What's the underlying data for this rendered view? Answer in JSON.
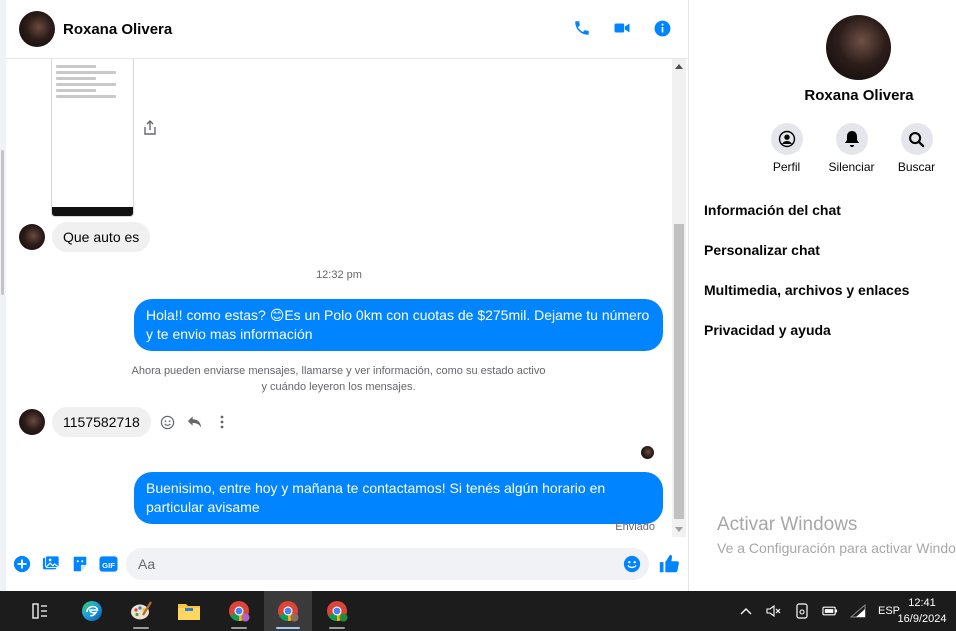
{
  "header": {
    "contact_name": "Roxana Olivera"
  },
  "messages": {
    "incoming_1": "Que auto es",
    "timestamp": "12:32 pm",
    "outgoing_1": "Hola!! como estas? 😊Es un Polo 0km con cuotas de $275mil. Dejame tu número y te envio mas información",
    "system_note_line1": "Ahora pueden enviarse mensajes, llamarse y ver información, como su estado activo",
    "system_note_line2": "y cuándo leyeron los mensajes.",
    "incoming_2": "1157582718",
    "outgoing_2": "Buenisimo, entre hoy y mañana te contactamos! Si tenés algún horario en particular avisame",
    "status": "Enviado"
  },
  "composer": {
    "placeholder": "Aa"
  },
  "info_panel": {
    "name": "Roxana Olivera",
    "actions": {
      "profile": "Perfil",
      "mute": "Silenciar",
      "search": "Buscar"
    },
    "menu": [
      "Información del chat",
      "Personalizar chat",
      "Multimedia, archivos y enlaces",
      "Privacidad y ayuda"
    ]
  },
  "watermark": {
    "title": "Activar Windows",
    "subtitle": "Ve a Configuración para activar Windows."
  },
  "taskbar": {
    "language": "ESP",
    "time": "12:41",
    "date": "16/9/2024"
  },
  "colors": {
    "messenger_blue": "#0084ff",
    "taskbar": "#1c1c1c"
  }
}
